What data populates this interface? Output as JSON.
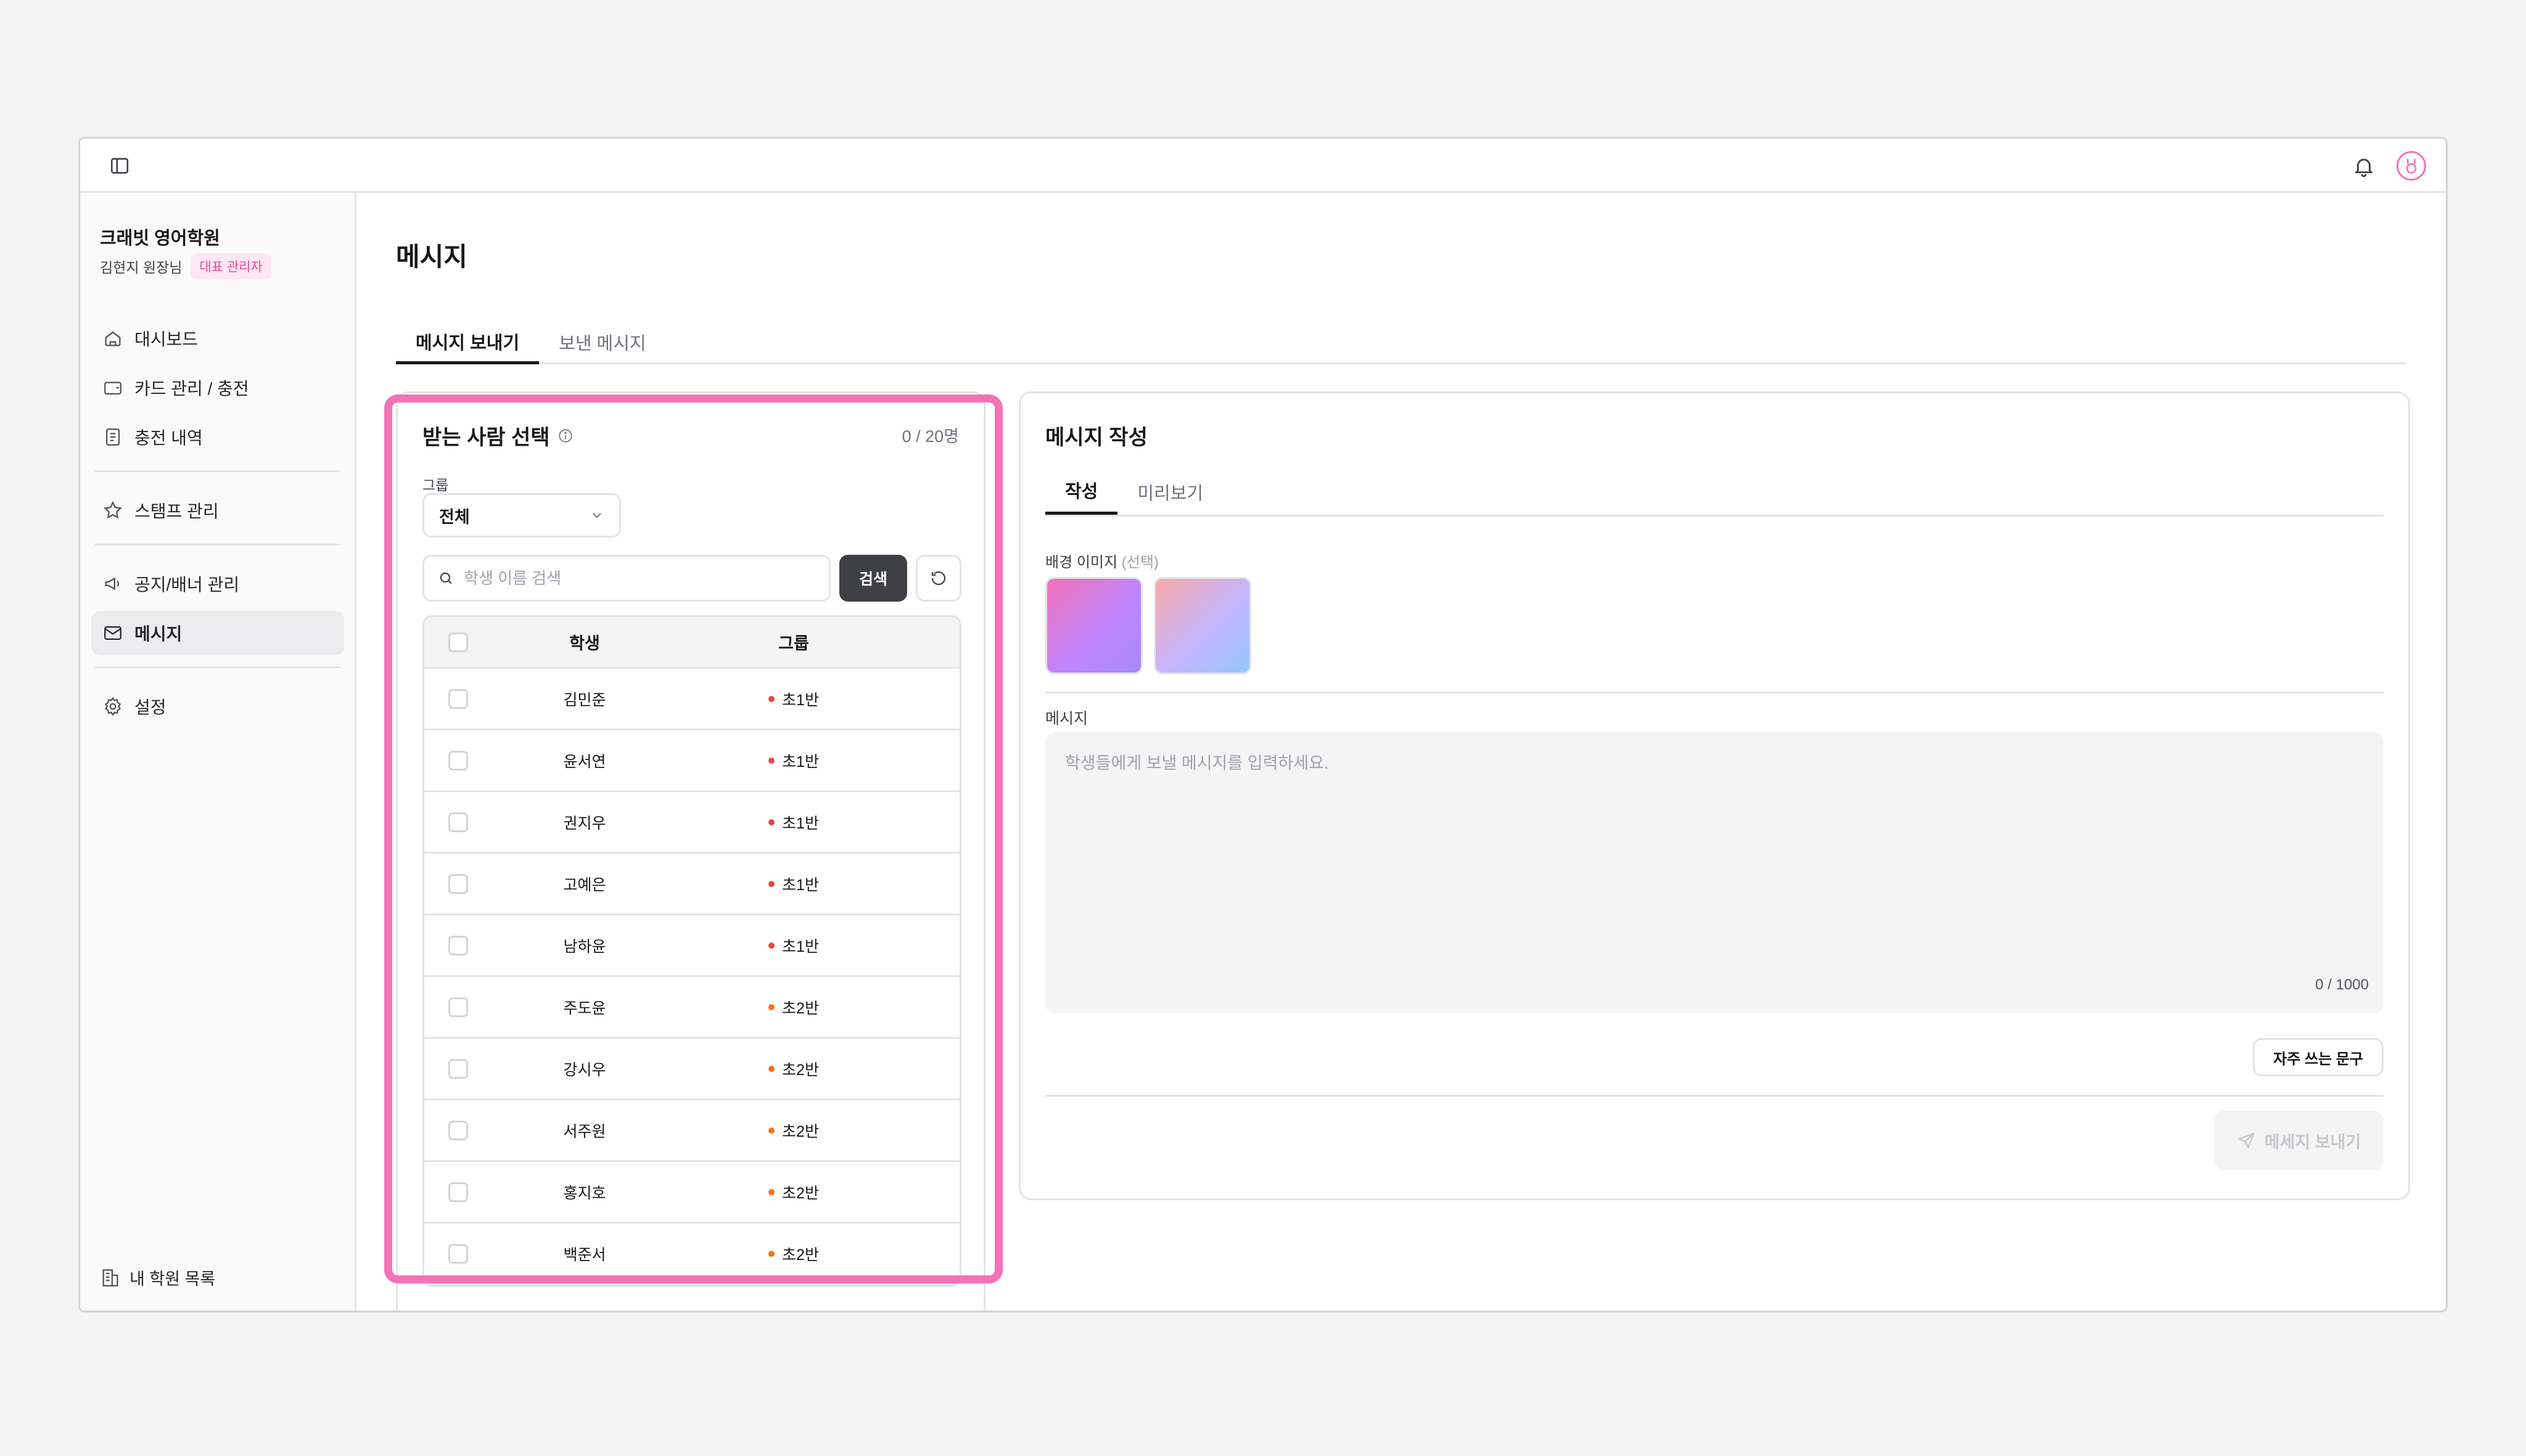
{
  "org": {
    "name": "크래빗 영어학원",
    "user": "김현지 원장님",
    "role": "대표 관리자"
  },
  "nav": {
    "dashboard": "대시보드",
    "cards": "카드 관리 / 충전",
    "history": "충전 내역",
    "stamps": "스탬프 관리",
    "notices": "공지/배너 관리",
    "messages": "메시지",
    "settings": "설정",
    "my_academies": "내 학원 목록"
  },
  "page": {
    "title": "메시지",
    "tabs": [
      "메시지 보내기",
      "보낸 메시지"
    ]
  },
  "recipients": {
    "title": "받는 사람 선택",
    "count": "0 / 20명",
    "group_label": "그룹",
    "group_value": "전체",
    "search_placeholder": "학생 이름 검색",
    "search_button": "검색",
    "headers": {
      "student": "학생",
      "group": "그룹"
    },
    "rows": [
      {
        "name": "김민준",
        "group": "초1반",
        "color": "#ef4444"
      },
      {
        "name": "윤서연",
        "group": "초1반",
        "color": "#ef4444"
      },
      {
        "name": "권지우",
        "group": "초1반",
        "color": "#ef4444"
      },
      {
        "name": "고예은",
        "group": "초1반",
        "color": "#ef4444"
      },
      {
        "name": "남하윤",
        "group": "초1반",
        "color": "#ef4444"
      },
      {
        "name": "주도윤",
        "group": "초2반",
        "color": "#f97316"
      },
      {
        "name": "강시우",
        "group": "초2반",
        "color": "#f97316"
      },
      {
        "name": "서주원",
        "group": "초2반",
        "color": "#f97316"
      },
      {
        "name": "홍지호",
        "group": "초2반",
        "color": "#f97316"
      },
      {
        "name": "백준서",
        "group": "초2반",
        "color": "#f97316"
      }
    ]
  },
  "compose": {
    "title": "메시지 작성",
    "subtabs": [
      "작성",
      "미리보기"
    ],
    "bg_label": "배경 이미지",
    "bg_optional": "(선택)",
    "message_label": "메시지",
    "message_placeholder": "학생들에게 보낼 메시지를 입력하세요.",
    "char_count": "0 / 1000",
    "phrases_button": "자주 쓰는 문구",
    "send_button": "메세지 보내기"
  },
  "colors": {
    "accent": "#f472b6",
    "group1": "#ef4444",
    "group2": "#f97316"
  }
}
